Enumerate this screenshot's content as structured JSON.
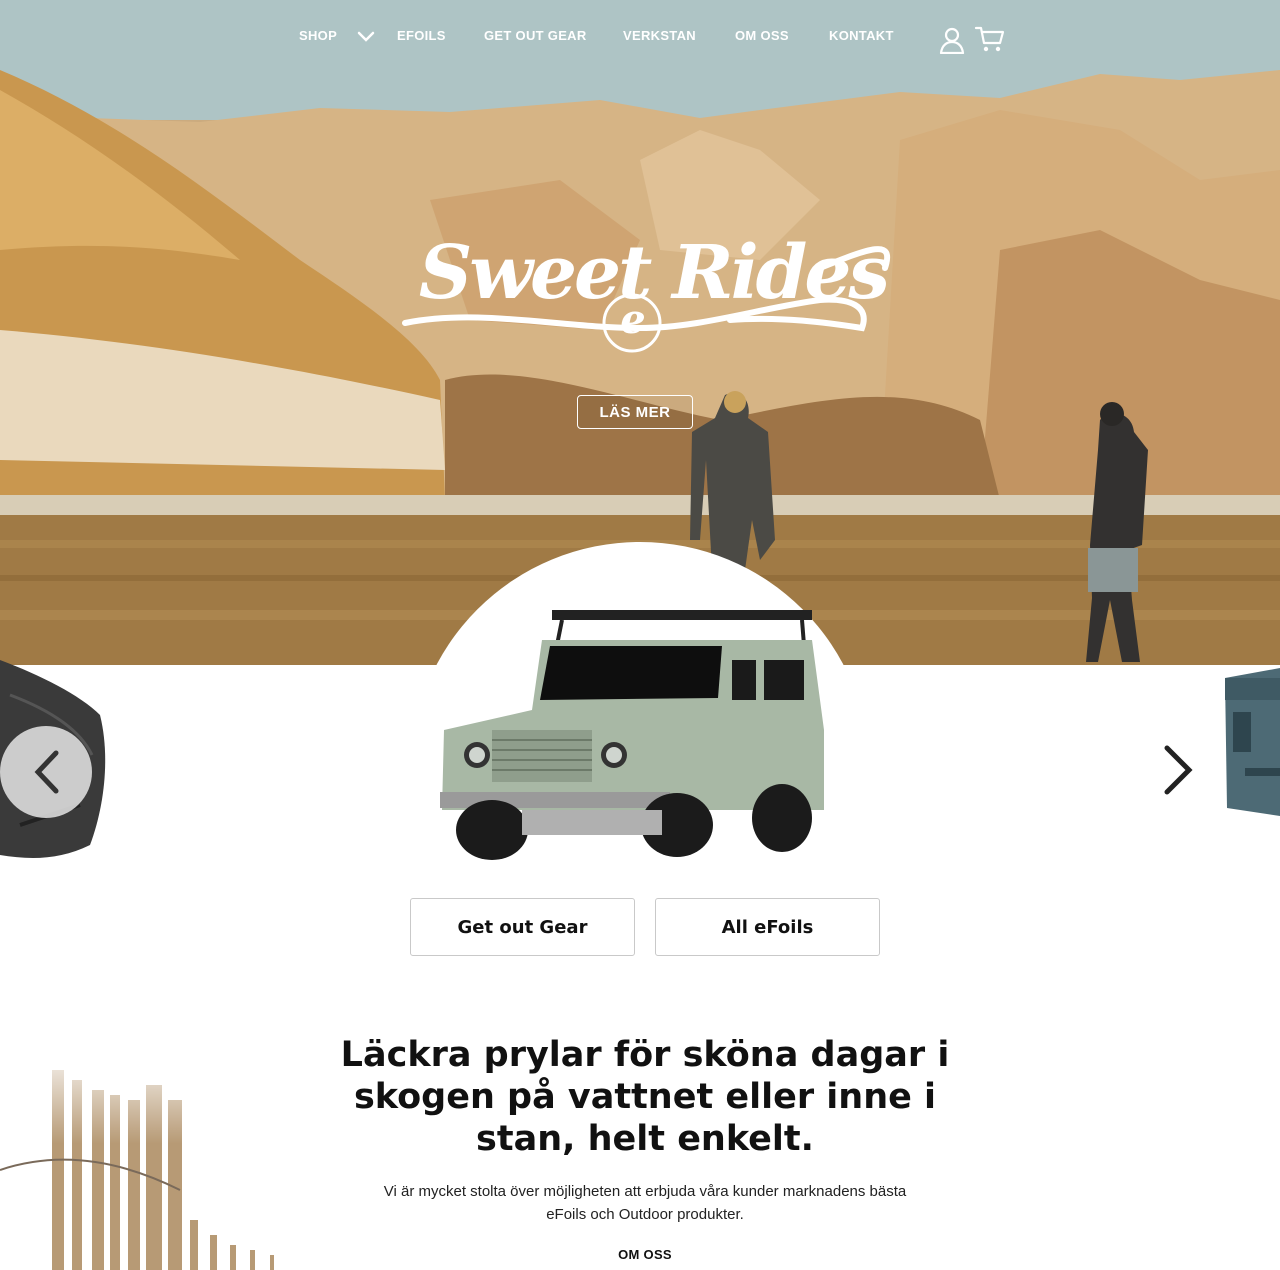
{
  "nav": {
    "shop_label": "SHOP",
    "items": [
      "EFOILS",
      "GET OUT GEAR",
      "VERKSTAN",
      "OM OSS",
      "KONTAKT"
    ],
    "icons": [
      "user-icon",
      "cart-icon"
    ]
  },
  "hero": {
    "logo_text": "Sweet Rides",
    "logo_mark": "e",
    "button_label": "LÄS MER"
  },
  "carousel": {
    "prev_icon": "chevron-left-icon",
    "next_icon": "chevron-right-icon"
  },
  "ctas": [
    "Get out Gear",
    "All eFoils"
  ],
  "intro": {
    "headline_lines": [
      "Läckra prylar för sköna dagar i",
      "skogen på vattnet eller inne i",
      "stan, helt enkelt."
    ],
    "body_lines": [
      "Vi är mycket stolta över möjligheten att erbjuda våra kunder marknadens bästa",
      "eFoils och Outdoor produkter."
    ],
    "link_label": "OM OSS"
  },
  "colors": {
    "sky": "#b3c7c6",
    "sand": "#cfa772",
    "water": "#9a7440",
    "text": "#111111",
    "button_border": "#c9c9c9"
  }
}
